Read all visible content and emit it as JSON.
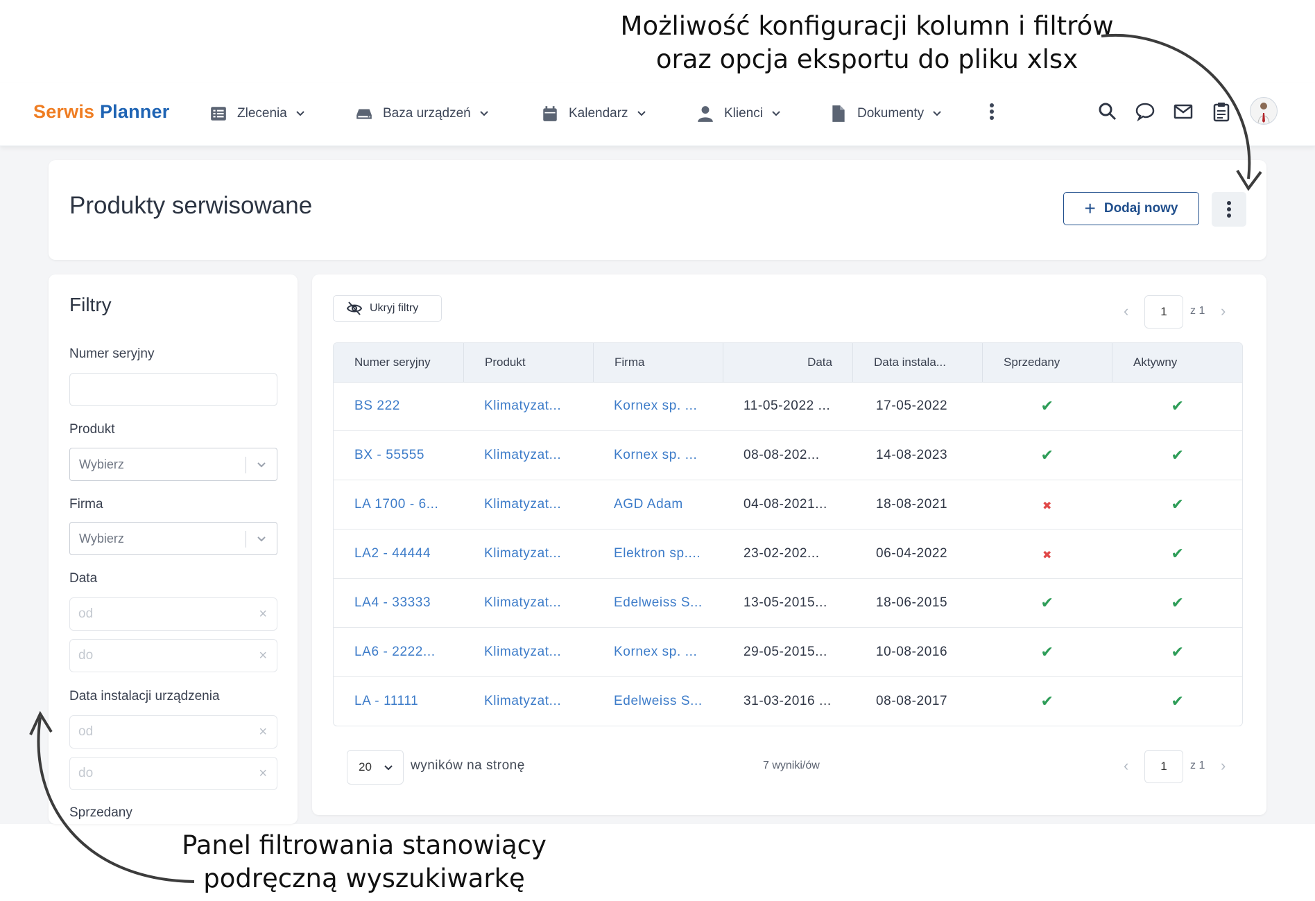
{
  "annotations": {
    "top_line1": "Możliwość konfiguracji kolumn i filtrów",
    "top_line2": "oraz opcja eksportu do pliku xlsx",
    "bottom_line1": "Panel filtrowania stanowiący",
    "bottom_line2": "podręczną wyszukiwarkę"
  },
  "brand": {
    "part1": "Serwis",
    "part2": "Planner"
  },
  "nav": {
    "items": [
      {
        "label": "Zlecenia",
        "icon": "list-icon"
      },
      {
        "label": "Baza urządzeń",
        "icon": "device-icon"
      },
      {
        "label": "Kalendarz",
        "icon": "calendar-icon"
      },
      {
        "label": "Klienci",
        "icon": "person-icon"
      },
      {
        "label": "Dokumenty",
        "icon": "document-icon"
      }
    ]
  },
  "header": {
    "title": "Produkty serwisowane",
    "add_label": "Dodaj nowy"
  },
  "filters": {
    "title": "Filtry",
    "serial_label": "Numer seryjny",
    "serial_value": "",
    "product_label": "Produkt",
    "product_placeholder": "Wybierz",
    "company_label": "Firma",
    "company_placeholder": "Wybierz",
    "date_label": "Data",
    "date_from": "od",
    "date_to": "do",
    "install_label": "Data instalacji urządzenia",
    "install_from": "od",
    "install_to": "do",
    "sold_label": "Sprzedany"
  },
  "table": {
    "hide_filters": "Ukryj filtry",
    "page": "1",
    "page_of": "z 1",
    "columns": [
      "Numer seryjny",
      "Produkt",
      "Firma",
      "Data",
      "Data instala...",
      "Sprzedany",
      "Aktywny"
    ],
    "rows": [
      {
        "serial": "BS 222",
        "product": "Klimatyzat...",
        "company": "Kornex sp. ...",
        "date": "11-05-2022 ...",
        "install": "17-05-2022",
        "sold": true,
        "active": true
      },
      {
        "serial": "BX - 55555",
        "product": "Klimatyzat...",
        "company": "Kornex sp. ...",
        "date": "08-08-202...",
        "install": "14-08-2023",
        "sold": true,
        "active": true
      },
      {
        "serial": "LA 1700 - 6...",
        "product": "Klimatyzat...",
        "company": "AGD Adam",
        "date": "04-08-2021...",
        "install": "18-08-2021",
        "sold": false,
        "active": true
      },
      {
        "serial": "LA2 - 44444",
        "product": "Klimatyzat...",
        "company": "Elektron sp....",
        "date": "23-02-202...",
        "install": "06-04-2022",
        "sold": false,
        "active": true
      },
      {
        "serial": "LA4 - 33333",
        "product": "Klimatyzat...",
        "company": "Edelweiss S...",
        "date": "13-05-2015...",
        "install": "18-06-2015",
        "sold": true,
        "active": true
      },
      {
        "serial": "LA6 - 2222...",
        "product": "Klimatyzat...",
        "company": "Kornex sp. ...",
        "date": "29-05-2015...",
        "install": "10-08-2016",
        "sold": true,
        "active": true
      },
      {
        "serial": "LA - 11111",
        "product": "Klimatyzat...",
        "company": "Edelweiss S...",
        "date": "31-03-2016 ...",
        "install": "08-08-2017",
        "sold": true,
        "active": true
      }
    ],
    "per_page": "20",
    "per_page_label": "wyników na stronę",
    "result_count": "7 wyniki/ów"
  },
  "colors": {
    "brand_orange": "#ef7d22",
    "brand_blue": "#1f64b4",
    "link": "#3d7cc9",
    "ok": "#2e9d58",
    "no": "#e04848"
  }
}
